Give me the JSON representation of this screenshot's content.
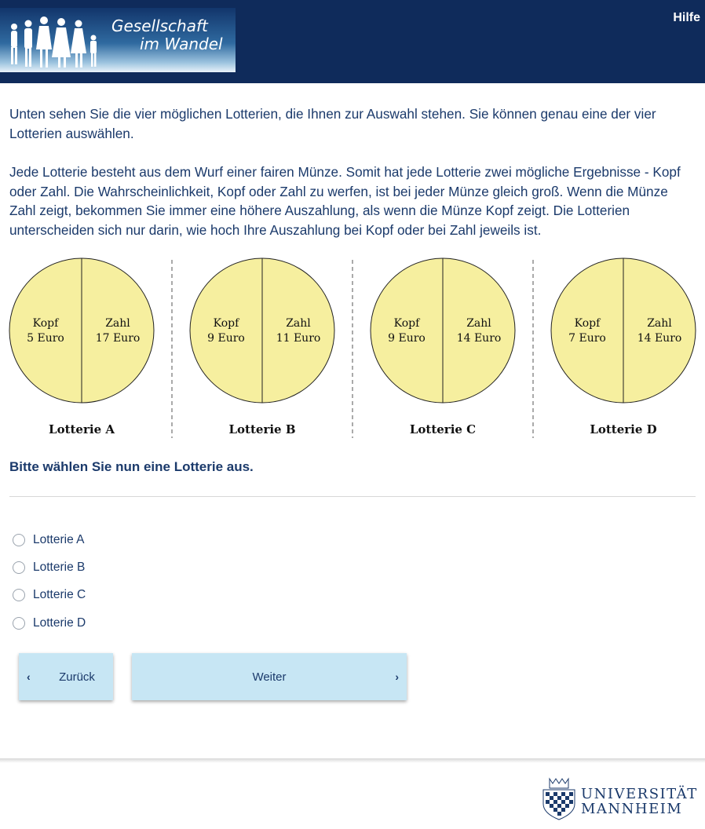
{
  "header": {
    "logo_line1": "Gesellschaft",
    "logo_line2": "im Wandel",
    "help_label": "Hilfe"
  },
  "intro": {
    "paragraph1": "Unten sehen Sie die vier möglichen Lotterien, die Ihnen zur Auswahl stehen. Sie können genau eine der vier Lotterien auswählen.",
    "paragraph2": "Jede Lotterie besteht aus dem Wurf einer fairen Münze. Somit hat jede Lotterie zwei mögliche Ergebnisse - Kopf oder Zahl. Die Wahrscheinlichkeit, Kopf oder Zahl zu werfen, ist bei jeder Münze gleich groß. Wenn die Münze Zahl zeigt, bekommen Sie immer eine höhere Auszahlung, als wenn die Münze Kopf zeigt. Die Lotterien unterscheiden sich nur darin, wie hoch Ihre Auszahlung bei Kopf oder bei Zahl jeweils ist."
  },
  "lotteries": [
    {
      "name": "Lotterie A",
      "kopf_label": "Kopf",
      "kopf_value": "5 Euro",
      "zahl_label": "Zahl",
      "zahl_value": "17 Euro"
    },
    {
      "name": "Lotterie B",
      "kopf_label": "Kopf",
      "kopf_value": "9 Euro",
      "zahl_label": "Zahl",
      "zahl_value": "11 Euro"
    },
    {
      "name": "Lotterie C",
      "kopf_label": "Kopf",
      "kopf_value": "9 Euro",
      "zahl_label": "Zahl",
      "zahl_value": "14 Euro"
    },
    {
      "name": "Lotterie D",
      "kopf_label": "Kopf",
      "kopf_value": "7 Euro",
      "zahl_label": "Zahl",
      "zahl_value": "14 Euro"
    }
  ],
  "question": "Bitte wählen Sie nun eine Lotterie aus.",
  "options": [
    "Lotterie A",
    "Lotterie B",
    "Lotterie C",
    "Lotterie D"
  ],
  "nav": {
    "back_label": "Zurück",
    "next_label": "Weiter"
  },
  "footer": {
    "uni_line1": "UNIVERSITÄT",
    "uni_line2": "MANNHEIM"
  },
  "colors": {
    "header_bg": "#0f2b5b",
    "text": "#1b3a6b",
    "coin_fill": "#f6ef9f",
    "button_bg": "#c7e6f4"
  }
}
